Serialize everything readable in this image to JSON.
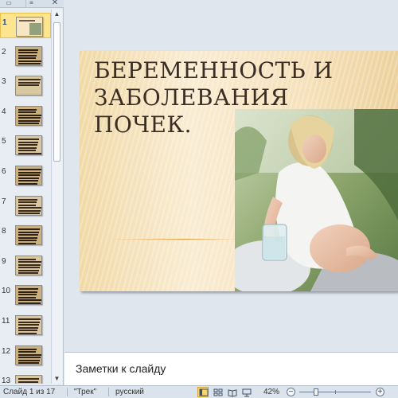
{
  "pane": {
    "tab_slides_icon": "slides-tab-icon",
    "tab_outline_icon": "outline-tab-icon",
    "close_glyph": "✕",
    "selected_slide": 1,
    "slide_numbers": [
      "1",
      "2",
      "3",
      "4",
      "5",
      "6",
      "7",
      "8",
      "9",
      "10",
      "11",
      "12",
      "13"
    ]
  },
  "slide": {
    "title_line1": "БЕРЕМЕННОСТЬ И",
    "title_line2": "ЗАБОЛЕВАНИЯ ПОЧЕК."
  },
  "notes": {
    "placeholder": "Заметки к слайду"
  },
  "status": {
    "slide_counter": "Слайд 1 из 17",
    "theme": "\"Трек\"",
    "language": "русский",
    "zoom_level": "42%",
    "zoom_out_glyph": "−",
    "zoom_in_glyph": "+"
  },
  "colors": {
    "selection": "#fde58f",
    "title_text": "#3a2e24",
    "accent_line": "#e59a3a",
    "active_view": "#fbd66f"
  }
}
